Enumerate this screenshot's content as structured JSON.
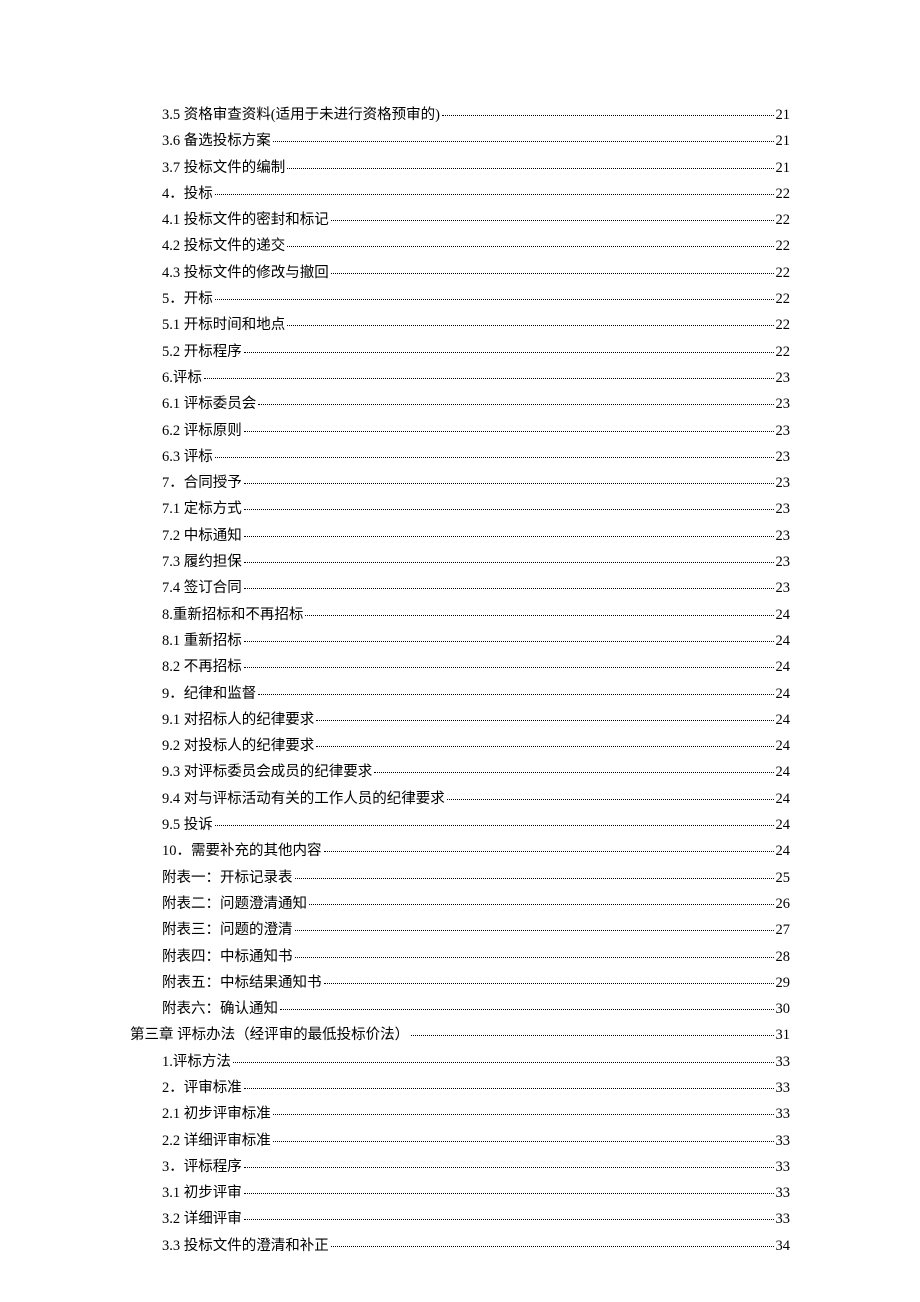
{
  "toc": [
    {
      "level": 2,
      "label": "3.5 资格审查资料(适用于未进行资格预审的)",
      "page": "21"
    },
    {
      "level": 2,
      "label": "3.6 备选投标方案",
      "page": "21"
    },
    {
      "level": 2,
      "label": "3.7 投标文件的编制",
      "page": "21"
    },
    {
      "level": 2,
      "label": "4．投标",
      "page": "22"
    },
    {
      "level": 2,
      "label": "4.1 投标文件的密封和标记",
      "page": "22"
    },
    {
      "level": 2,
      "label": "4.2 投标文件的递交",
      "page": "22"
    },
    {
      "level": 2,
      "label": "4.3 投标文件的修改与撤回",
      "page": "22"
    },
    {
      "level": 2,
      "label": "5．开标",
      "page": "22"
    },
    {
      "level": 2,
      "label": "5.1 开标时间和地点",
      "page": "22"
    },
    {
      "level": 2,
      "label": "5.2 开标程序",
      "page": "22"
    },
    {
      "level": 2,
      "label": "6.评标",
      "page": "23"
    },
    {
      "level": 2,
      "label": "6.1 评标委员会",
      "page": "23"
    },
    {
      "level": 2,
      "label": "6.2 评标原则",
      "page": "23"
    },
    {
      "level": 2,
      "label": "6.3 评标",
      "page": "23"
    },
    {
      "level": 2,
      "label": "7．合同授予",
      "page": "23"
    },
    {
      "level": 2,
      "label": "7.1 定标方式",
      "page": "23"
    },
    {
      "level": 2,
      "label": "7.2 中标通知",
      "page": "23"
    },
    {
      "level": 2,
      "label": "7.3 履约担保",
      "page": "23"
    },
    {
      "level": 2,
      "label": "7.4 签订合同",
      "page": "23"
    },
    {
      "level": 2,
      "label": "8.重新招标和不再招标",
      "page": "24"
    },
    {
      "level": 2,
      "label": "8.1 重新招标",
      "page": "24"
    },
    {
      "level": 2,
      "label": "8.2 不再招标",
      "page": "24"
    },
    {
      "level": 2,
      "label": "9．纪律和监督",
      "page": "24"
    },
    {
      "level": 2,
      "label": "9.1 对招标人的纪律要求",
      "page": "24"
    },
    {
      "level": 2,
      "label": "9.2 对投标人的纪律要求",
      "page": "24"
    },
    {
      "level": 2,
      "label": "9.3 对评标委员会成员的纪律要求",
      "page": "24"
    },
    {
      "level": 2,
      "label": "9.4 对与评标活动有关的工作人员的纪律要求",
      "page": "24"
    },
    {
      "level": 2,
      "label": "9.5 投诉",
      "page": "24"
    },
    {
      "level": 2,
      "label": "10．需要补充的其他内容",
      "page": "24"
    },
    {
      "level": 2,
      "label": "附表一：开标记录表",
      "page": "25"
    },
    {
      "level": 2,
      "label": "附表二：问题澄清通知",
      "page": "26"
    },
    {
      "level": 2,
      "label": "附表三：问题的澄清",
      "page": "27"
    },
    {
      "level": 2,
      "label": "附表四：中标通知书",
      "page": "28"
    },
    {
      "level": 2,
      "label": "附表五：中标结果通知书",
      "page": "29"
    },
    {
      "level": 2,
      "label": "附表六：确认通知",
      "page": "30"
    },
    {
      "level": 1,
      "label": "第三章  评标办法（经评审的最低投标价法）",
      "page": "31"
    },
    {
      "level": 2,
      "label": "1.评标方法",
      "page": "33"
    },
    {
      "level": 2,
      "label": "2．评审标准",
      "page": "33"
    },
    {
      "level": 2,
      "label": "2.1 初步评审标准",
      "page": "33"
    },
    {
      "level": 2,
      "label": "2.2 详细评审标准",
      "page": "33"
    },
    {
      "level": 2,
      "label": "3．评标程序",
      "page": "33"
    },
    {
      "level": 2,
      "label": "3.1 初步评审",
      "page": "33"
    },
    {
      "level": 2,
      "label": "3.2 详细评审",
      "page": "33"
    },
    {
      "level": 2,
      "label": "3.3 投标文件的澄清和补正",
      "page": "34"
    }
  ]
}
